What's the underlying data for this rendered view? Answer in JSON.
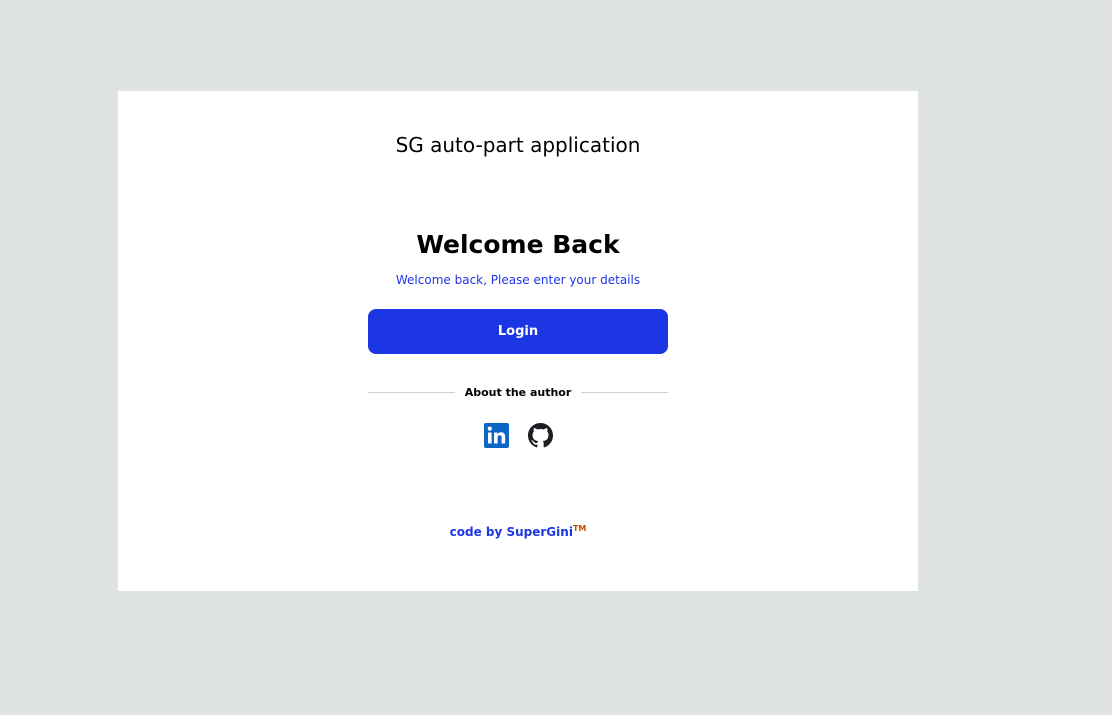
{
  "app": {
    "title": "SG auto-part application"
  },
  "login": {
    "heading": "Welcome Back",
    "subheading": "Welcome back, Please enter your details",
    "button_label": "Login"
  },
  "author_section": {
    "label": "About the author",
    "links": [
      {
        "icon": "linkedin-icon",
        "color": "#0a66c2"
      },
      {
        "icon": "github-icon",
        "color": "#1b1f23"
      }
    ]
  },
  "footer": {
    "text": "code by SuperGini",
    "trademark": "TM"
  },
  "colors": {
    "accent": "#1d36e3",
    "background": "#e0e3e4",
    "card": "#ffffff",
    "trademark": "#c84b00"
  }
}
